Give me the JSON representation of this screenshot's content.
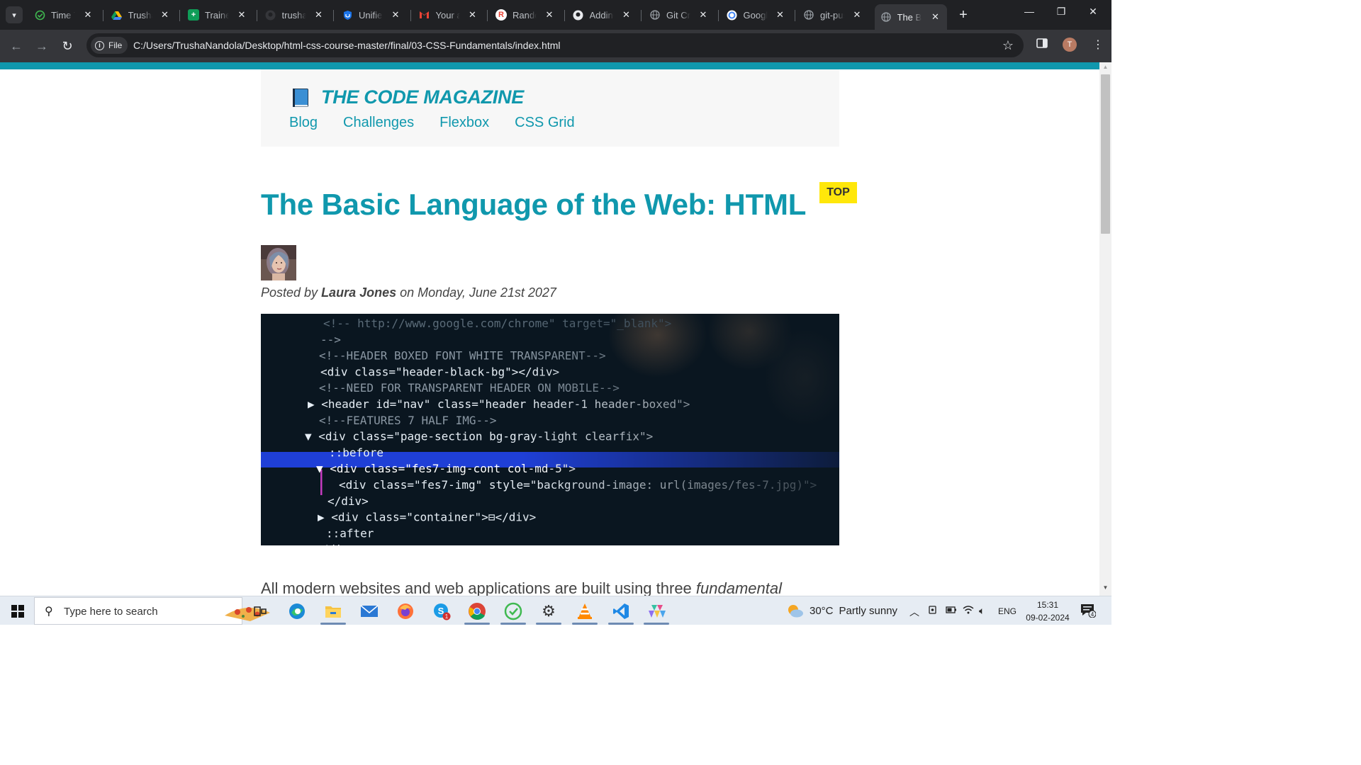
{
  "browser": {
    "tabs": [
      {
        "title": "Time Tracker",
        "favicon": "clock-check-icon",
        "color": "#3fb950"
      },
      {
        "title": "Trusha - Google Drive",
        "favicon": "google-drive-icon",
        "color": "#1a73e8"
      },
      {
        "title": "Trainee Sheet",
        "favicon": "google-sheets-icon",
        "color": "#0f9d58"
      },
      {
        "title": "trusha",
        "favicon": "github-icon",
        "color": "#202124"
      },
      {
        "title": "Unified",
        "favicon": "shield-icon",
        "color": "#1a73e8"
      },
      {
        "title": "Your account",
        "favicon": "gmail-icon",
        "color": "#ea4335"
      },
      {
        "title": "Random",
        "favicon": "r-logo-icon",
        "color": "#ea4335"
      },
      {
        "title": "Adding",
        "favicon": "github-icon",
        "color": "#e8eaed"
      },
      {
        "title": "Git Create",
        "favicon": "globe-icon",
        "color": "#9aa0a6"
      },
      {
        "title": "Google",
        "favicon": "google-icon",
        "color": "#4285f4"
      },
      {
        "title": "git-push",
        "favicon": "globe-icon",
        "color": "#9aa0a6"
      },
      {
        "title": "The Basic Language of the Web: HTML",
        "favicon": "globe-icon",
        "color": "#9aa0a6",
        "active": true
      }
    ],
    "chip_label": "File",
    "url": "C:/Users/TrushaNandola/Desktop/html-css-course-master/final/03-CSS-Fundamentals/index.html",
    "profile_initial": "T"
  },
  "page": {
    "site_title": "THE CODE MAGAZINE",
    "nav": [
      "Blog",
      "Challenges",
      "Flexbox",
      "CSS Grid"
    ],
    "badge": "TOP",
    "article_title": "The Basic Language of the Web: HTML",
    "byline": {
      "prefix": "Posted by ",
      "author": "Laura Jones",
      "suffix": " on Monday, June 21st 2027"
    },
    "intro": {
      "text": "All modern websites and web applications are built using three ",
      "emphasis": "fundamental"
    },
    "accent_color": "#1098ad",
    "badge_color": "#ffe70a"
  },
  "code_image": {
    "lines": [
      {
        "text": "<!-- http://www.google.com/chrome\" target=\"_blank\">",
        "color": "#5a6b78"
      },
      {
        "text": "-->",
        "color": "#8a97a3"
      },
      {
        "text": "<!--HEADER BOXED FONT WHITE TRANSPARENT-->",
        "color": "#8a97a3"
      },
      {
        "text": "<div class=\"header-black-bg\"></div>",
        "color": "#e6eef5"
      },
      {
        "text": "<!--NEED FOR TRANSPARENT HEADER ON MOBILE-->",
        "color": "#8a97a3"
      },
      {
        "text": "▶ <header id=\"nav\" class=\"header header-1 header-boxed\">",
        "color": "#e6eef5"
      },
      {
        "text": "<!--FEATURES 7 HALF IMG-->",
        "color": "#8a97a3"
      },
      {
        "text": "▼ <div class=\"page-section bg-gray-light clearfix\">",
        "color": "#e6eef5"
      },
      {
        "text": "::before",
        "color": "#e6eef5"
      },
      {
        "text": "▼ <div class=\"fes7-img-cont col-md-5\">",
        "color": "#ffffff"
      },
      {
        "text": "<div class=\"fes7-img\" style=\"background-image: url(images/fes-7.jpg)\">",
        "color": "#e6eef5"
      },
      {
        "text": "</div>",
        "color": "#e6eef5"
      },
      {
        "text": "▶ <div class=\"container\">⊟</div>",
        "color": "#e6eef5"
      },
      {
        "text": "::after",
        "color": "#e6eef5"
      },
      {
        "text": "</div>",
        "color": "#e6eef5"
      }
    ]
  },
  "taskbar": {
    "search_placeholder": "Type here to search",
    "apps": [
      "task-view-icon",
      "edge-icon",
      "file-explorer-icon",
      "mail-icon",
      "firefox-icon",
      "skype-icon",
      "chrome-icon",
      "time-tracker-icon",
      "settings-icon",
      "vlc-icon",
      "vscode-icon",
      "git-kraken-icon"
    ],
    "skype_badge": "1",
    "weather": {
      "temp": "30°C",
      "desc": "Partly sunny"
    },
    "language": "ENG",
    "time": "15:31",
    "date": "09-02-2024",
    "notification_count": "4"
  }
}
